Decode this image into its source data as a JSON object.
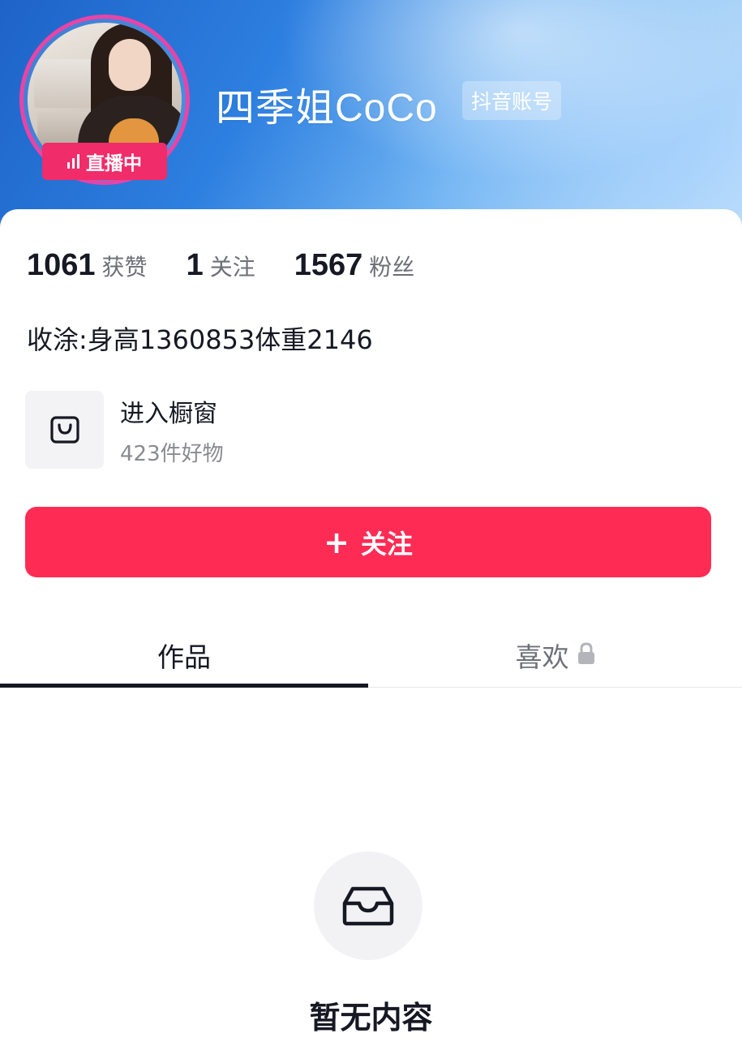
{
  "profile": {
    "nickname": "四季姐CoCo",
    "account_tag": "抖音账号",
    "live_label": "直播中",
    "bio": "收涂:身高1360853体重2146"
  },
  "stats": [
    {
      "value": "1061",
      "label": "获赞"
    },
    {
      "value": "1",
      "label": "关注"
    },
    {
      "value": "1567",
      "label": "粉丝"
    }
  ],
  "shop": {
    "title": "进入橱窗",
    "subtitle": "423件好物",
    "icon": "shopping-bag-icon"
  },
  "follow_button": {
    "icon": "+",
    "label": "关注"
  },
  "tabs": [
    {
      "label": "作品",
      "active": true
    },
    {
      "label": "喜欢",
      "locked": true,
      "icon": "lock-icon"
    }
  ],
  "empty_state": {
    "icon": "inbox-tray-icon",
    "text": "暂无内容"
  },
  "colors": {
    "accent": "#fe2c55",
    "live_badge": "#f02c6a",
    "avatar_ring": "#e844a6"
  }
}
